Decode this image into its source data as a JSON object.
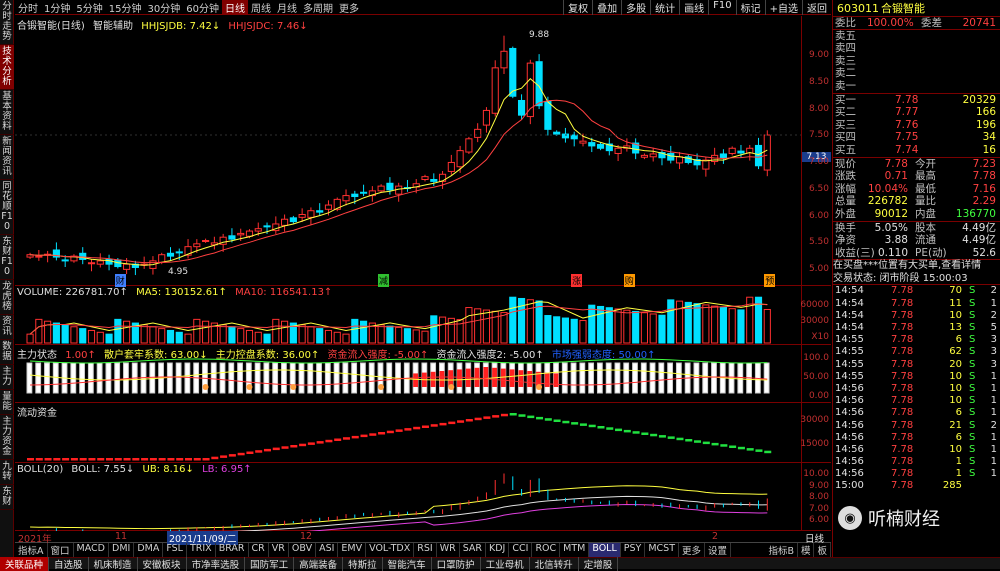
{
  "topbar": {
    "periods": [
      "分时",
      "1分钟",
      "5分钟",
      "15分钟",
      "30分钟",
      "60分钟",
      "日线",
      "周线",
      "月线",
      "多周期",
      "更多"
    ],
    "active_period": "日线",
    "right": [
      "复权",
      "叠加",
      "多股",
      "统计",
      "画线",
      "F10",
      "标记",
      "+自选",
      "返回"
    ]
  },
  "leftbar": [
    {
      "label": "分时走势",
      "active": false
    },
    {
      "label": "技术分析",
      "active": true
    },
    {
      "label": "基本资料",
      "active": false
    },
    {
      "label": "新闻资讯",
      "active": false
    },
    {
      "label": "同花顺F10",
      "active": false
    },
    {
      "label": "东财F10",
      "active": false
    },
    {
      "label": "龙虎榜",
      "active": false
    },
    {
      "label": "资讯",
      "active": false
    },
    {
      "label": "数据",
      "active": false
    },
    {
      "label": "主力",
      "active": false
    },
    {
      "label": "量能",
      "active": false
    },
    {
      "label": "主力资金",
      "active": false
    },
    {
      "label": "九转",
      "active": false
    },
    {
      "label": "东财",
      "active": false
    }
  ],
  "main_panel": {
    "stock": "合锻智能(日线)",
    "indicator": "智能辅助",
    "hhjsjdb": "HHJSJDB: 7.42↓",
    "hhjsjdc": "HHJSJDC: 7.46↓",
    "high_label": "9.88",
    "low_label": "4.95",
    "y_labels": [
      "9.00",
      "8.50",
      "8.00",
      "7.50",
      "7.00",
      "6.50",
      "6.00",
      "5.50",
      "5.00"
    ],
    "current_price_tag": "7.13",
    "markers": [
      {
        "text": "财",
        "color": "#4080ff"
      },
      {
        "text": "减",
        "color": "#30c030"
      },
      {
        "text": "涨",
        "color": "#ff3030"
      },
      {
        "text": "购",
        "color": "#ff9900"
      },
      {
        "text": "预",
        "color": "#ff9900"
      }
    ]
  },
  "volume_panel": {
    "volume": "VOLUME: 226781.70↑",
    "ma5": "MA5: 130152.61↑",
    "ma10": "MA10: 116541.13↑",
    "y_labels": [
      "60000",
      "30000"
    ],
    "unit": "X10"
  },
  "main_state_panel": {
    "title": "主力状态",
    "v1": "1.00↑",
    "v2": "散户套牢系数: 63.00↓",
    "v3": "主力控盘系数: 36.00↑",
    "v4": "资金流入强度: -5.00↑",
    "v5": "资金流入强度2: -5.00↑",
    "v6": "市场强弱态度: 50.00↑",
    "y_labels": [
      "100.0",
      "50.00",
      "0.00"
    ]
  },
  "flow_panel": {
    "title": "流动资金",
    "y_labels": [
      "30000",
      "15000"
    ]
  },
  "boll_panel": {
    "boll": "BOLL(20)",
    "value": "BOLL: 7.55↓",
    "ub": "UB: 8.16↓",
    "lb": "LB: 6.95↑",
    "y_labels": [
      "10.00",
      "9.00",
      "8.00",
      "7.00",
      "6.00"
    ]
  },
  "datebar": {
    "year": "2021年",
    "m1": "11",
    "cursor_date": "2021/11/09/二",
    "m2": "12",
    "m3": "2"
  },
  "indicators": [
    "指标A",
    "窗口",
    "MACD",
    "DMI",
    "DMA",
    "FSL",
    "TRIX",
    "BRAR",
    "CR",
    "VR",
    "OBV",
    "ASI",
    "EMV",
    "VOL-TDX",
    "RSI",
    "WR",
    "SAR",
    "KDJ",
    "CCI",
    "ROC",
    "MTM",
    "BOLL",
    "PSY",
    "MCST",
    "更多",
    "设置"
  ],
  "active_indicator": "BOLL",
  "indbar_right": [
    "指标B",
    "模",
    "板"
  ],
  "bottombar": [
    "关联品种",
    "自选股",
    "机床制造",
    "安徽板块",
    "市净率选股",
    "国防军工",
    "高端装备",
    "特斯拉",
    "智能汽车",
    "口罩防护",
    "工业母机",
    "北信转升",
    "定增股"
  ],
  "right": {
    "code": "603011",
    "name": "合锻智能",
    "weibi": "委比",
    "weibi_val": "100.00%",
    "weicha": "委差",
    "weicha_val": "20741",
    "sells": [
      {
        "label": "卖五"
      },
      {
        "label": "卖四"
      },
      {
        "label": "卖三"
      },
      {
        "label": "卖二"
      },
      {
        "label": "卖一"
      }
    ],
    "buys": [
      {
        "label": "买一",
        "price": "7.78",
        "vol": "20329"
      },
      {
        "label": "买二",
        "price": "7.77",
        "vol": "166"
      },
      {
        "label": "买三",
        "price": "7.76",
        "vol": "196"
      },
      {
        "label": "买四",
        "price": "7.75",
        "vol": "34"
      },
      {
        "label": "买五",
        "price": "7.74",
        "vol": "16"
      }
    ],
    "quotes": [
      {
        "l1": "现价",
        "v1": "7.78",
        "l2": "今开",
        "v2": "7.23"
      },
      {
        "l1": "涨跌",
        "v1": "0.71",
        "l2": "最高",
        "v2": "7.78"
      },
      {
        "l1": "涨幅",
        "v1": "10.04%",
        "l2": "最低",
        "v2": "7.16"
      },
      {
        "l1": "总量",
        "v1": "226782",
        "l2": "量比",
        "v2": "2.29"
      },
      {
        "l1": "外盘",
        "v1": "90012",
        "l2": "内盘",
        "v2": "136770"
      }
    ],
    "stats": [
      {
        "l1": "换手",
        "v1": "5.05%",
        "l2": "股本",
        "v2": "4.49亿"
      },
      {
        "l1": "净资",
        "v1": "3.88",
        "l2": "流通",
        "v2": "4.49亿"
      },
      {
        "l1": "收益(三)",
        "v1": "0.110",
        "l2": "PE(动)",
        "v2": "52.6"
      }
    ],
    "notice": "在买盘***位置有大买单,查看详情",
    "status": "交易状态: 闭市阶段 15:00:03",
    "ticks": [
      [
        "14:54",
        "7.78",
        "70",
        "S",
        "2"
      ],
      [
        "14:54",
        "7.78",
        "11",
        "S",
        "1"
      ],
      [
        "14:54",
        "7.78",
        "10",
        "S",
        "2"
      ],
      [
        "14:54",
        "7.78",
        "13",
        "S",
        "5"
      ],
      [
        "14:55",
        "7.78",
        "6",
        "S",
        "3"
      ],
      [
        "14:55",
        "7.78",
        "62",
        "S",
        "3"
      ],
      [
        "14:55",
        "7.78",
        "20",
        "S",
        "3"
      ],
      [
        "14:55",
        "7.78",
        "10",
        "S",
        "1"
      ],
      [
        "14:56",
        "7.78",
        "10",
        "S",
        "1"
      ],
      [
        "14:56",
        "7.78",
        "10",
        "S",
        "1"
      ],
      [
        "14:56",
        "7.78",
        "6",
        "S",
        "1"
      ],
      [
        "14:56",
        "7.78",
        "21",
        "S",
        "2"
      ],
      [
        "14:56",
        "7.78",
        "6",
        "S",
        "1"
      ],
      [
        "14:56",
        "7.78",
        "10",
        "S",
        "1"
      ],
      [
        "14:56",
        "7.78",
        "1",
        "S",
        "1"
      ],
      [
        "14:56",
        "7.78",
        "1",
        "S",
        "1"
      ],
      [
        "15:00",
        "7.78",
        "285",
        "",
        ""
      ]
    ]
  },
  "watermark": "听楠财经",
  "chart_data": {
    "type": "candlestick",
    "title": "合锻智能(日线)",
    "series": [
      {
        "name": "HHJSJDB",
        "last": 7.42
      },
      {
        "name": "HHJSJDC",
        "last": 7.46
      }
    ],
    "high": 9.88,
    "low": 4.95,
    "ylim": [
      4.8,
      10.0
    ],
    "last_close": 7.78,
    "volume_last": 226781.7,
    "ma5": 130152.61,
    "ma10": 116541.13,
    "boll": {
      "mid": 7.55,
      "ub": 8.16,
      "lb": 6.95
    },
    "closes": [
      5.25,
      5.22,
      5.26,
      5.2,
      5.12,
      5.22,
      5.15,
      5.08,
      5.12,
      5.05,
      5.0,
      5.05,
      4.98,
      5.05,
      5.12,
      5.25,
      5.22,
      5.3,
      5.42,
      5.48,
      5.55,
      5.5,
      5.62,
      5.58,
      5.7,
      5.75,
      5.8,
      5.85,
      5.9,
      6.0,
      5.95,
      6.1,
      6.18,
      6.15,
      6.3,
      6.42,
      6.5,
      6.48,
      6.56,
      6.6,
      6.7,
      6.62,
      6.7,
      6.65,
      6.75,
      6.9,
      6.8,
      6.95,
      7.2,
      7.45,
      7.7,
      7.9,
      8.3,
      9.2,
      9.55,
      8.6,
      8.2,
      9.3,
      8.4,
      7.9,
      7.8,
      7.72,
      7.7,
      7.65,
      7.55,
      7.5,
      7.45,
      7.5,
      7.55,
      7.4,
      7.35,
      7.38,
      7.3,
      7.25,
      7.32,
      7.2,
      7.15,
      7.25,
      7.35,
      7.3,
      7.5,
      7.4,
      7.5,
      7.13,
      7.78
    ]
  }
}
